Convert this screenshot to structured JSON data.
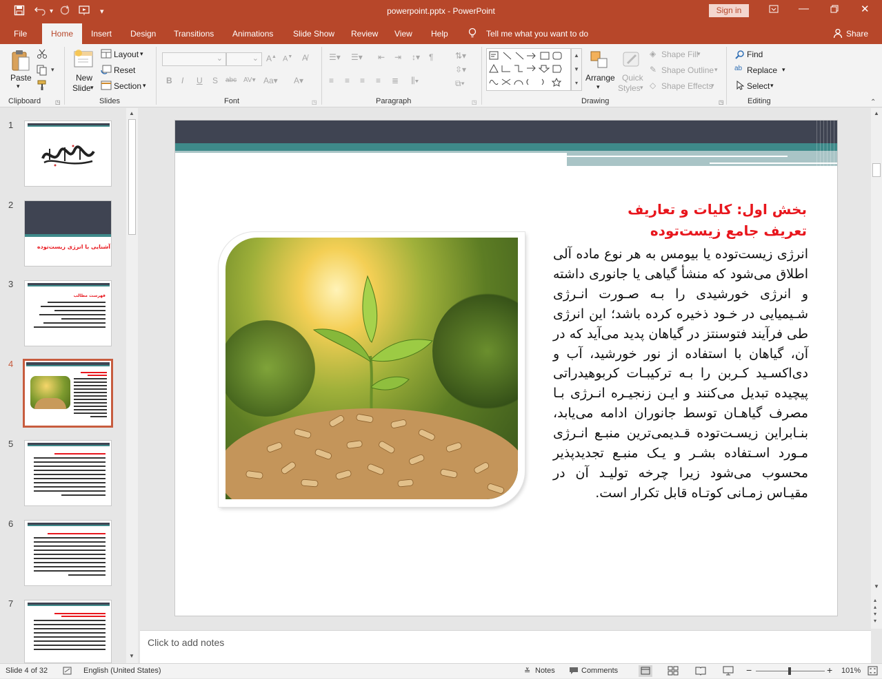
{
  "window": {
    "title": "powerpoint.pptx  -  PowerPoint",
    "sign_in": "Sign in"
  },
  "tabs": [
    "File",
    "Home",
    "Insert",
    "Design",
    "Transitions",
    "Animations",
    "Slide Show",
    "Review",
    "View",
    "Help"
  ],
  "tell_me": "Tell me what you want to do",
  "share": "Share",
  "ribbon": {
    "clipboard": {
      "paste": "Paste",
      "label": "Clipboard"
    },
    "slides": {
      "new_slide_1": "New",
      "new_slide_2": "Slide",
      "layout": "Layout",
      "reset": "Reset",
      "section": "Section",
      "label": "Slides"
    },
    "font": {
      "label": "Font"
    },
    "paragraph": {
      "label": "Paragraph"
    },
    "drawing": {
      "arrange": "Arrange",
      "quick_styles_1": "Quick",
      "quick_styles_2": "Styles",
      "shape_fill": "Shape Fill",
      "shape_outline": "Shape Outline",
      "shape_effects": "Shape Effects",
      "label": "Drawing"
    },
    "editing": {
      "find": "Find",
      "replace": "Replace",
      "select": "Select",
      "label": "Editing"
    }
  },
  "thumbnails": [
    {
      "num": "1",
      "text": ""
    },
    {
      "num": "2",
      "text": "آشنایی با انرژی زیست‌توده"
    },
    {
      "num": "3",
      "text": "فهرست مطالب"
    },
    {
      "num": "4",
      "text": ""
    },
    {
      "num": "5",
      "text": ""
    },
    {
      "num": "6",
      "text": ""
    },
    {
      "num": "7",
      "text": ""
    }
  ],
  "selected_slide": 4,
  "slide": {
    "heading_line1": "بخش اول: کلیات و تعاریف",
    "heading_line2": "تعریف جامع زیست‌توده",
    "body": "انرژی زیست‌توده یا بیومس به هر نوع ماده آلی اطلاق می‌شود که منشأ گیاهی یا جانوری داشته و انرژی خورشیدی را بـه صـورت انـرژی شـیمیایی در خـود ذخیره کرده باشد؛ این انرژی طی فرآیند فتوسنتز در گیاهان پدید می‌آید که در آن، گیاهان با استفاده از نور خورشید، آب و دی‌اکسـید کـربن را بـه ترکیبـات کربوهیدراتی پیچیده تبدیل می‌کنند و ایـن زنجیـره انـرژی بـا مصرف گیاهـان توسط جانوران ادامه می‌یابد، بنـابراین زیسـت‌توده قـدیمی‌ترین منبـع انـرژی مـورد اسـتفاده بشـر و یـک منبـع تجدیدپذیر محسوب می‌شود زیرا چرخه تولیـد آن در مقیـاس زمـانی کوتـاه قابل تکرار است."
  },
  "notes_placeholder": "Click to add notes",
  "status": {
    "slide_info": "Slide 4 of 32",
    "language": "English (United States)",
    "notes": "Notes",
    "comments": "Comments",
    "zoom": "101%"
  },
  "colors": {
    "brand": "#b7472a",
    "heading_red": "#e8161d",
    "slide_band": "#3f4452",
    "slide_teal": "#3e8a8a"
  }
}
